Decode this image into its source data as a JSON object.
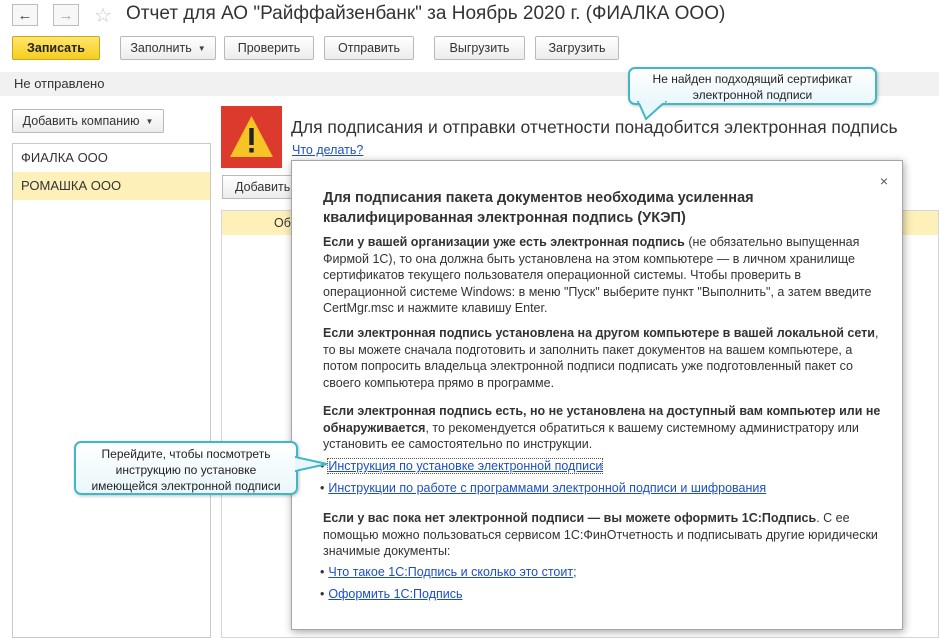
{
  "window": {
    "title": "Отчет для АО \"Райффайзенбанк\" за Ноябрь 2020 г. (ФИАЛКА ООО)"
  },
  "toolbar": {
    "save": "Записать",
    "fill": "Заполнить",
    "check": "Проверить",
    "send": "Отправить",
    "export": "Выгрузить",
    "import": "Загрузить"
  },
  "status": "Не отправлено",
  "left_panel": {
    "add_company": "Добавить компанию",
    "companies": [
      "ФИАЛКА ООО",
      "РОМАШКА ООО"
    ]
  },
  "warning": {
    "title": "Для подписания и отправки отчетности понадобится электронная подпись",
    "what_to_do": "Что делать?"
  },
  "background": {
    "add_button": "Добавить",
    "table_header": "Об"
  },
  "popup": {
    "close": "×",
    "title": "Для подписания пакета документов необходима усиленная квалифицированная электронная подпись (УКЭП)",
    "p1_bold": "Если у вашей организации уже есть электронная подпись",
    "p1_text": " (не обязательно выпущенная Фирмой 1С), то она должна быть установлена на этом компьютере — в личном хранилище сертификатов текущего пользователя операционной системы. Чтобы проверить в операционной системе Windows: в меню \"Пуск\" выберите пункт \"Выполнить\", а затем введите CertMgr.msc и нажмите клавишу Enter.",
    "p2_bold": "Если электронная подпись установлена на другом компьютере в вашей локальной сети",
    "p2_text": ", то вы можете сначала подготовить и заполнить пакет документов на вашем компьютере, а потом попросить владельца электронной подписи подписать уже подготовленный пакет со своего компьютера прямо в программе.",
    "p3_bold": "Если электронная подпись есть, но не установлена на доступный вам компьютер или не обнаруживается",
    "p3_text": ", то рекомендуется обратиться к вашему системному администратору или установить ее самостоятельно по инструкции.",
    "link1": "Инструкция по установке электронной подписи",
    "link2": "Инструкции по работе с программами электронной подписи и шифрования",
    "p4_bold": "Если у вас пока нет электронной подписи — вы можете оформить 1С:Подпись",
    "p4_text": ". С ее помощью можно пользоваться сервисом 1С:ФинОтчетность и подписывать другие юридически значимые документы:",
    "link3": "Что такое 1С:Подпись и сколько это стоит;",
    "link4": "Оформить 1С:Подпись"
  },
  "callouts": {
    "top": "Не найден подходящий сертификат электронной подписи",
    "left": "Перейдите, чтобы посмотреть инструкцию по установке имеющейся электронной подписи"
  }
}
